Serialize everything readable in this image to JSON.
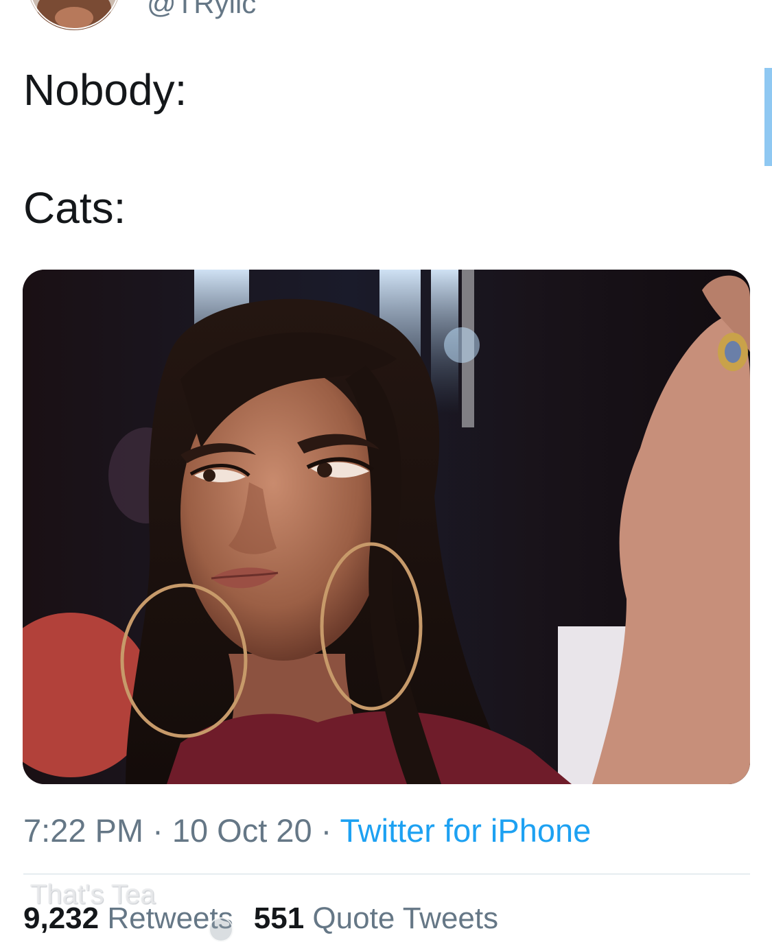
{
  "author": {
    "handle": "@TRylic",
    "avatar_icon": "profile-avatar"
  },
  "tweet": {
    "text": "Nobody:\n\nCats:",
    "media_icon": "photo-media"
  },
  "meta": {
    "time": "7:22 PM",
    "separator": " · ",
    "date": "10 Oct 20",
    "source": "Twitter for iPhone"
  },
  "stats": {
    "retweets_count": "9,232",
    "retweets_label": "Retweets",
    "quotes_count": "551",
    "quotes_label": "Quote Tweets"
  },
  "watermark": {
    "text": "That's Tea"
  },
  "colors": {
    "link_blue": "#1da1f2",
    "secondary_text": "#657786",
    "primary_text": "#14171a",
    "divider": "#e6ecf0",
    "scroll_indicator": "#8fc8f2"
  }
}
